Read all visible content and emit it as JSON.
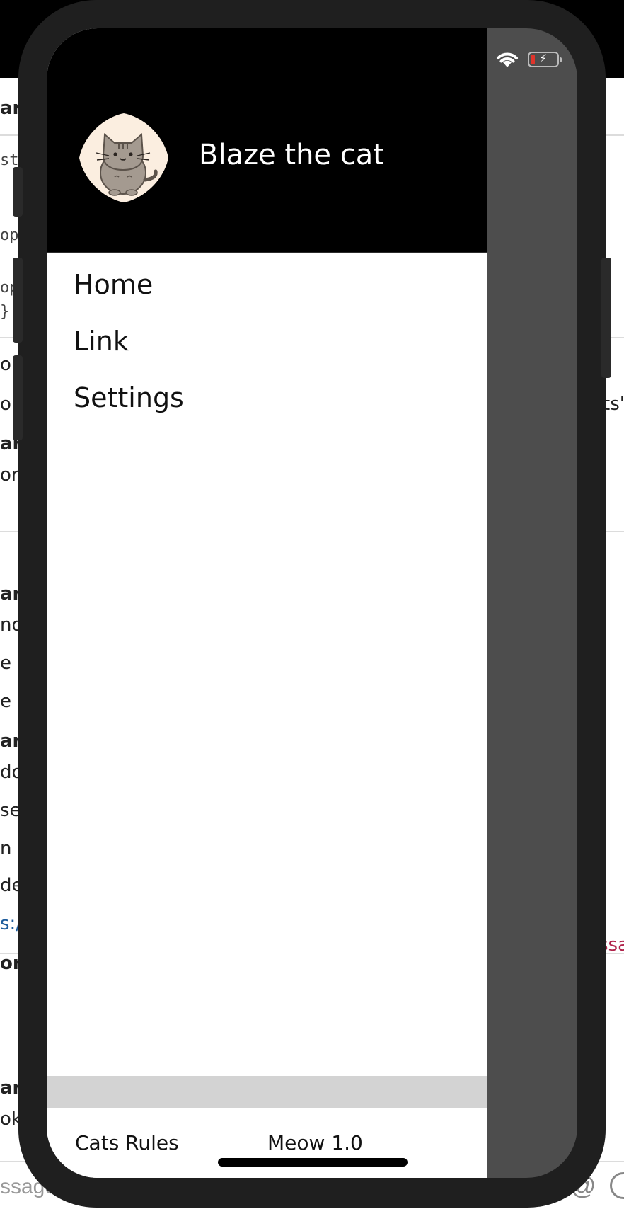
{
  "drawer": {
    "user_name": "Blaze the cat",
    "menu_items": [
      {
        "label": "Home"
      },
      {
        "label": "Link"
      },
      {
        "label": "Settings"
      }
    ],
    "footer": {
      "left_text": "Cats Rules",
      "right_text": "Meow 1.0"
    }
  },
  "background_app": {
    "fragments": [
      "ar",
      "sto",
      "opl",
      "op",
      "}",
      "or",
      "or",
      "ts'",
      "ar",
      "or",
      "ar",
      "nd",
      "e a",
      "e i",
      "ar",
      "do",
      "se",
      "n t",
      "de",
      "s:/",
      "ssa",
      "ori",
      "ar",
      "ok"
    ],
    "composer_placeholder": "ssage C",
    "mention_symbol": "@"
  },
  "colors": {
    "drawer_header_bg": "#000000",
    "overlay": "#4d4d4d",
    "divider": "#d3d3d3",
    "battery_low": "#e0342b"
  },
  "icons": {
    "status": [
      "wifi-icon",
      "battery-charging-icon"
    ],
    "avatar": "cat-avatar-icon"
  }
}
